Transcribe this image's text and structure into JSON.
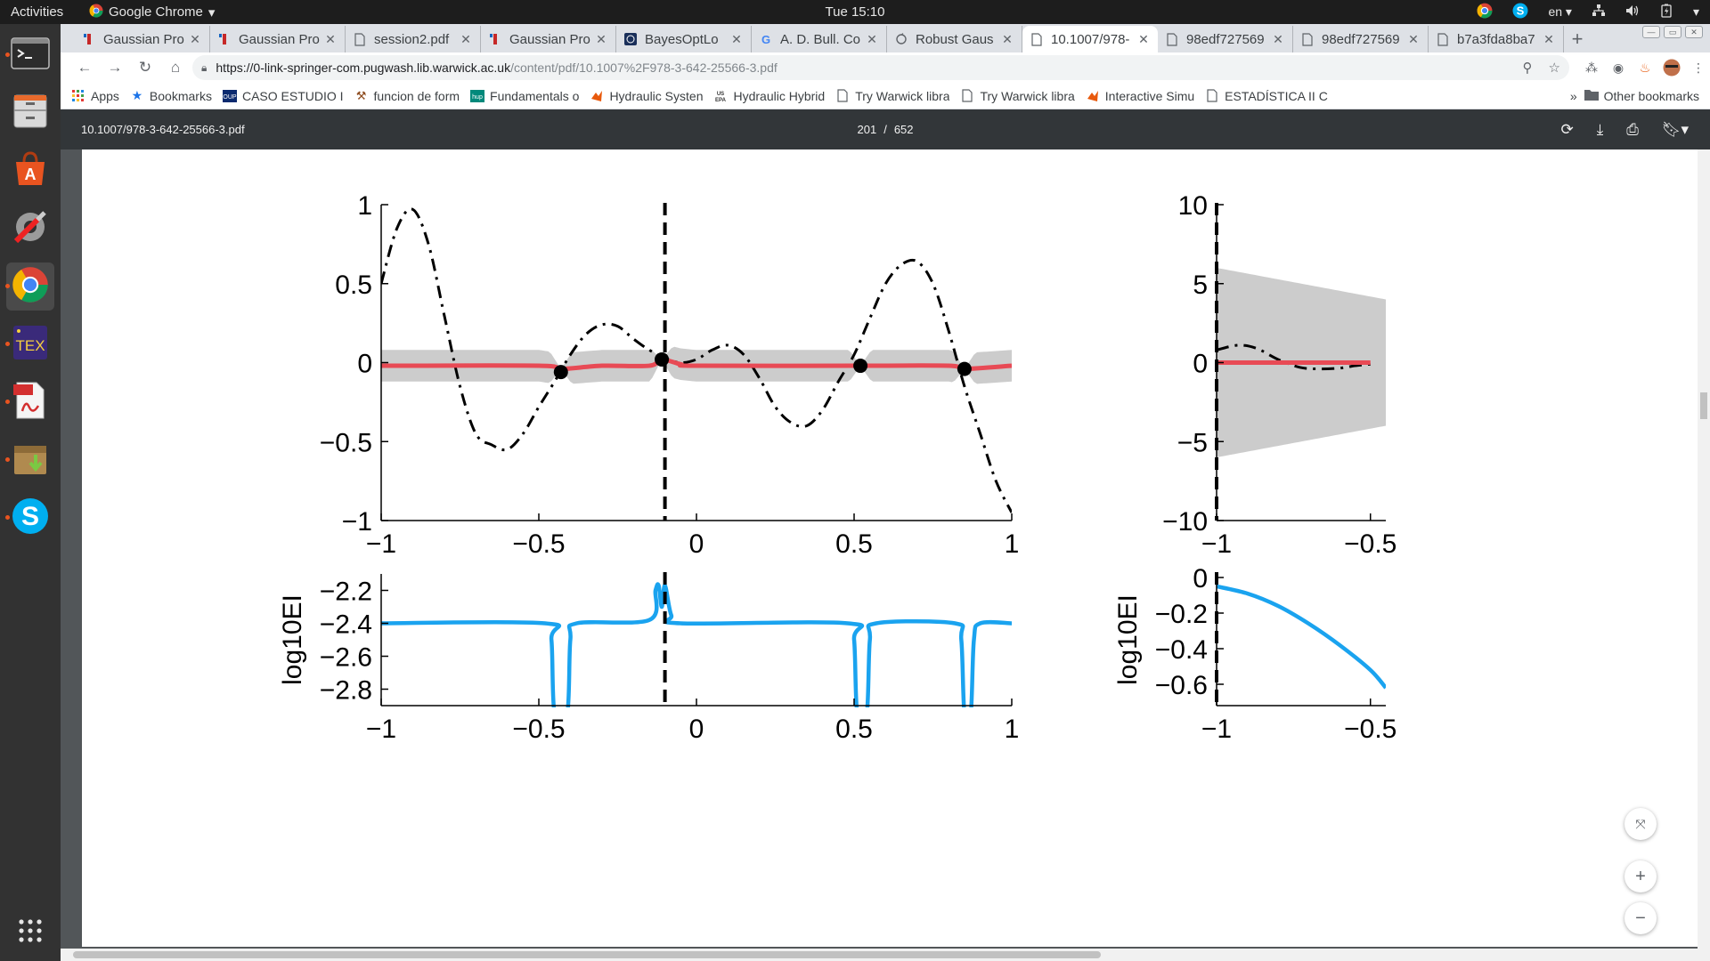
{
  "topbar": {
    "activities": "Activities",
    "app_name": "Google Chrome",
    "clock": "Tue 15:10",
    "lang": "en"
  },
  "tabs": [
    {
      "label": "Gaussian Pro",
      "icon": "wiki-icon",
      "active": false
    },
    {
      "label": "Gaussian Pro",
      "icon": "wiki-icon",
      "active": false
    },
    {
      "label": "session2.pdf",
      "icon": "document-icon",
      "active": false
    },
    {
      "label": "Gaussian Pro",
      "icon": "wiki-icon",
      "active": false
    },
    {
      "label": "BayesOptLo",
      "icon": "shield-icon",
      "active": false
    },
    {
      "label": "A. D. Bull. Co",
      "icon": "google-icon",
      "active": false
    },
    {
      "label": "Robust Gaus",
      "icon": "refresh-doc-icon",
      "active": false
    },
    {
      "label": "10.1007/978-",
      "icon": "document-icon",
      "active": true
    },
    {
      "label": "98edf727569",
      "icon": "document-icon",
      "active": false
    },
    {
      "label": "98edf727569",
      "icon": "document-icon",
      "active": false
    },
    {
      "label": "b7a3fda8ba7",
      "icon": "document-icon",
      "active": false
    }
  ],
  "address": {
    "host": "https://0-link-springer-com.pugwash.lib.warwick.ac.uk",
    "path": "/content/pdf/10.1007%2F978-3-642-25566-3.pdf"
  },
  "bookmarks": [
    {
      "label": "Apps",
      "icon": "apps-grid-icon"
    },
    {
      "label": "Bookmarks",
      "icon": "star-icon"
    },
    {
      "label": "CASO ESTUDIO I",
      "icon": "oup-icon"
    },
    {
      "label": "funcion de form",
      "icon": "hammer-icon"
    },
    {
      "label": "Fundamentals o",
      "icon": "hup-icon"
    },
    {
      "label": "Hydraulic Systen",
      "icon": "matlab-icon"
    },
    {
      "label": "Hydraulic Hybrid",
      "icon": "epa-icon"
    },
    {
      "label": "Try Warwick libra",
      "icon": "document-icon"
    },
    {
      "label": "Try Warwick libra",
      "icon": "document-icon"
    },
    {
      "label": "Interactive Simu",
      "icon": "matlab-icon"
    },
    {
      "label": "ESTADÍSTICA II C",
      "icon": "document-icon"
    }
  ],
  "bookmarks_more": "»",
  "bookmarks_other": "Other bookmarks",
  "pdf": {
    "title": "10.1007/978-3-642-25566-3.pdf",
    "page_current": "201",
    "page_sep": "/",
    "page_total": "652"
  },
  "chart_data": [
    {
      "type": "line",
      "panel": "left-top",
      "title": "",
      "xlabel": "",
      "ylabel": "",
      "xlim": [
        -1,
        1
      ],
      "ylim": [
        -1,
        1
      ],
      "xticks": [
        "−1",
        "−0.5",
        "0",
        "0.5",
        "1"
      ],
      "yticks": [
        "1",
        "0.5",
        "0",
        "−0.5",
        "−1"
      ],
      "series": [
        {
          "role": "objective",
          "style": "dash-dot",
          "color": "#000000",
          "x": [
            -1.0,
            -0.95,
            -0.9,
            -0.85,
            -0.8,
            -0.75,
            -0.7,
            -0.65,
            -0.6,
            -0.55,
            -0.5,
            -0.45,
            -0.4,
            -0.35,
            -0.3,
            -0.25,
            -0.2,
            -0.15,
            -0.1,
            -0.05,
            0.0,
            0.05,
            0.1,
            0.15,
            0.2,
            0.25,
            0.3,
            0.35,
            0.4,
            0.45,
            0.5,
            0.55,
            0.6,
            0.65,
            0.7,
            0.75,
            0.8,
            0.85,
            0.9,
            0.95,
            1.0
          ],
          "y": [
            0.5,
            0.85,
            0.97,
            0.75,
            0.3,
            -0.15,
            -0.45,
            -0.52,
            -0.55,
            -0.45,
            -0.28,
            -0.12,
            0.05,
            0.18,
            0.24,
            0.23,
            0.15,
            0.08,
            0.03,
            0.0,
            0.02,
            0.08,
            0.11,
            0.05,
            -0.1,
            -0.28,
            -0.38,
            -0.4,
            -0.3,
            -0.12,
            0.05,
            0.28,
            0.5,
            0.62,
            0.64,
            0.5,
            0.2,
            -0.15,
            -0.45,
            -0.75,
            -0.95
          ]
        },
        {
          "role": "posterior-mean",
          "style": "solid",
          "color": "#e84a55",
          "x": [
            -1.0,
            -0.5,
            -0.43,
            -0.3,
            -0.15,
            -0.11,
            -0.05,
            0.0,
            0.5,
            0.52,
            0.8,
            0.85,
            1.0
          ],
          "y": [
            -0.02,
            -0.02,
            -0.04,
            -0.02,
            -0.02,
            0.02,
            -0.01,
            -0.02,
            -0.02,
            -0.02,
            -0.02,
            -0.04,
            -0.02
          ]
        }
      ],
      "band": {
        "color": "#cccccc",
        "half_width": 0.1
      },
      "observations": [
        {
          "x": -0.43,
          "y": -0.06
        },
        {
          "x": -0.11,
          "y": 0.02
        },
        {
          "x": 0.52,
          "y": -0.02
        },
        {
          "x": 0.85,
          "y": -0.04
        }
      ],
      "vline": -0.1
    },
    {
      "type": "line",
      "panel": "left-bottom",
      "xlabel": "",
      "ylabel": "log10EI",
      "xlim": [
        -1,
        1
      ],
      "ylim": [
        -2.9,
        -2.1
      ],
      "xticks": [
        "−1",
        "−0.5",
        "0",
        "0.5",
        "1"
      ],
      "yticks": [
        "−2.2",
        "−2.4",
        "−2.6",
        "−2.8"
      ],
      "series": [
        {
          "role": "log-expected-improvement",
          "color": "#1aa3ef",
          "x": [
            -1.0,
            -0.48,
            -0.46,
            -0.45,
            -0.41,
            -0.4,
            -0.38,
            -0.15,
            -0.13,
            -0.12,
            -0.11,
            -0.1,
            -0.08,
            -0.05,
            0.48,
            0.5,
            0.51,
            0.54,
            0.55,
            0.57,
            0.82,
            0.84,
            0.85,
            0.87,
            0.88,
            0.9,
            1.0
          ],
          "y": [
            -2.4,
            -2.4,
            -2.5,
            -2.95,
            -2.95,
            -2.5,
            -2.4,
            -2.38,
            -2.2,
            -2.17,
            -2.3,
            -2.17,
            -2.35,
            -2.4,
            -2.4,
            -2.5,
            -2.95,
            -2.95,
            -2.5,
            -2.4,
            -2.4,
            -2.5,
            -2.95,
            -2.95,
            -2.5,
            -2.4,
            -2.4
          ]
        }
      ],
      "vline": -0.1
    },
    {
      "type": "line",
      "panel": "right-top",
      "xlim": [
        -1,
        -0.45
      ],
      "ylim": [
        -10,
        10
      ],
      "xticks": [
        "−1",
        "−0.5"
      ],
      "yticks": [
        "10",
        "5",
        "0",
        "−5",
        "−10"
      ],
      "series": [
        {
          "role": "objective",
          "style": "dash-dot",
          "color": "#000000",
          "x": [
            -1.0,
            -0.93,
            -0.87,
            -0.8,
            -0.73,
            -0.67,
            -0.6,
            -0.55,
            -0.5
          ],
          "y": [
            0.8,
            1.1,
            0.9,
            0.2,
            -0.3,
            -0.4,
            -0.35,
            -0.2,
            -0.1
          ]
        },
        {
          "role": "posterior-mean",
          "style": "solid",
          "color": "#e84a55",
          "x": [
            -1.0,
            -0.5
          ],
          "y": [
            0.0,
            0.0
          ]
        }
      ],
      "band": {
        "color": "#cccccc",
        "start_half_width": 6.0,
        "end_half_width": 4.0
      },
      "vline": -1.0
    },
    {
      "type": "line",
      "panel": "right-bottom",
      "ylabel": "log10EI",
      "xlim": [
        -1,
        -0.45
      ],
      "ylim": [
        -0.72,
        0.02
      ],
      "xticks": [
        "−1",
        "−0.5"
      ],
      "yticks": [
        "0",
        "−0.2",
        "−0.4",
        "−0.6"
      ],
      "series": [
        {
          "role": "log-expected-improvement",
          "color": "#1aa3ef",
          "x": [
            -1.0,
            -0.9,
            -0.8,
            -0.7,
            -0.6,
            -0.5,
            -0.45
          ],
          "y": [
            -0.05,
            -0.09,
            -0.16,
            -0.26,
            -0.38,
            -0.52,
            -0.62
          ]
        }
      ],
      "vline": -1.0
    }
  ]
}
